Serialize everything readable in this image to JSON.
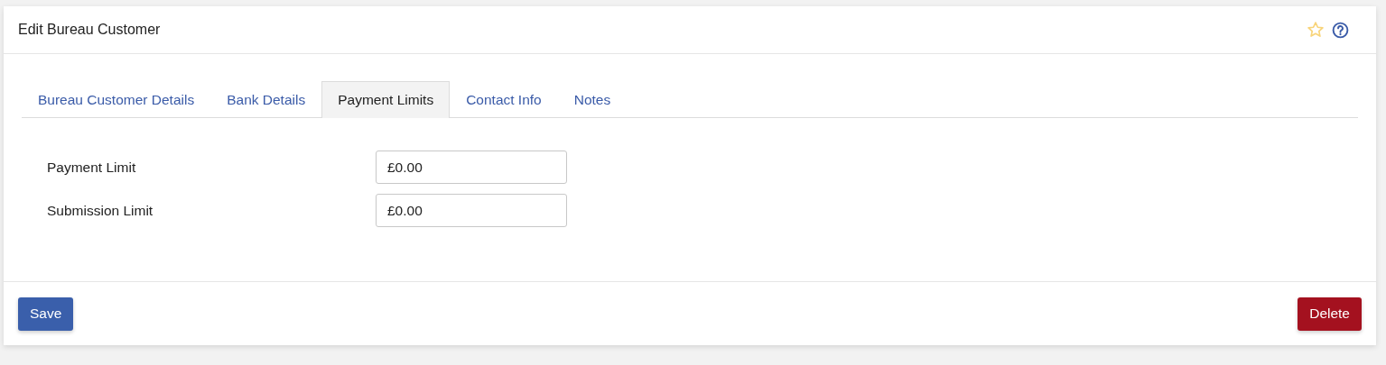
{
  "panel": {
    "title": "Edit Bureau Customer",
    "favourite": false
  },
  "tabs": [
    {
      "label": "Bureau Customer Details",
      "selected": false
    },
    {
      "label": "Bank Details",
      "selected": false
    },
    {
      "label": "Payment Limits",
      "selected": true
    },
    {
      "label": "Contact Info",
      "selected": false
    },
    {
      "label": "Notes",
      "selected": false
    }
  ],
  "fields": [
    {
      "label": "Payment Limit",
      "value": "£0.00"
    },
    {
      "label": "Submission Limit",
      "value": "£0.00"
    }
  ],
  "buttons": [
    {
      "label": "Save",
      "kind": "primary"
    },
    {
      "label": "Delete",
      "kind": "danger"
    }
  ]
}
